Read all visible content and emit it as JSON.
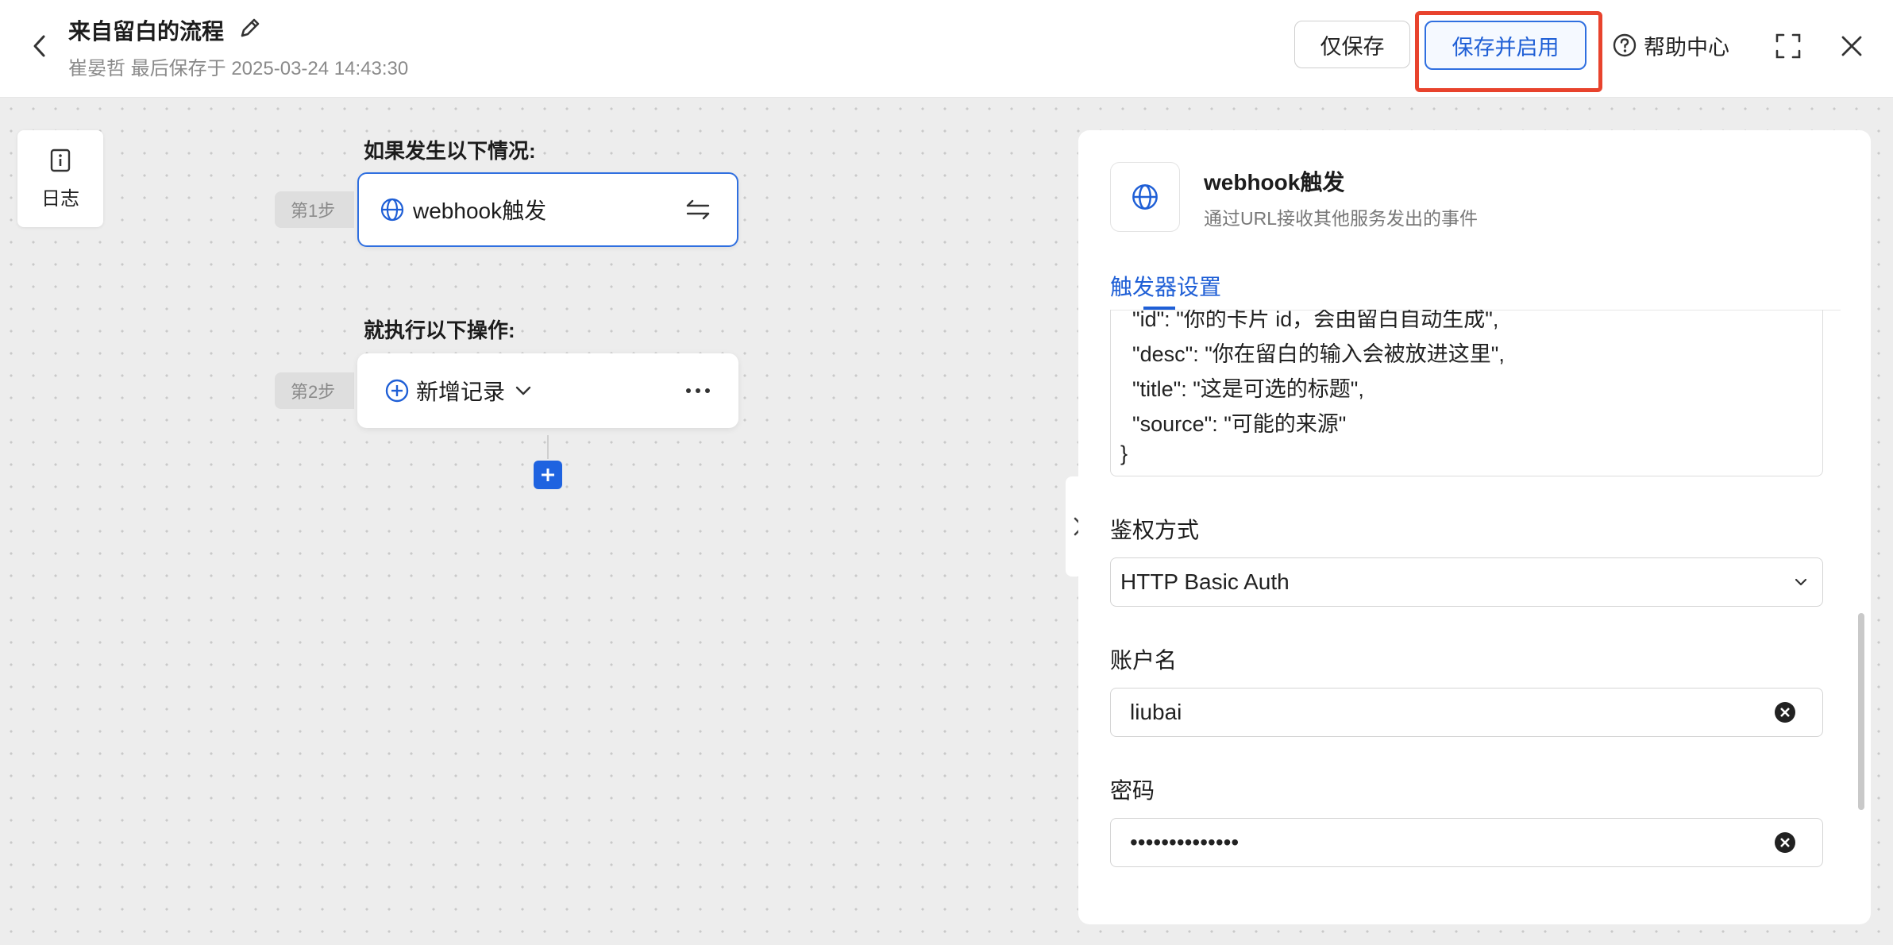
{
  "header": {
    "title": "来自留白的流程",
    "subtitle": "崔晏哲 最后保存于 2025-03-24 14:43:30",
    "save_only_label": "仅保存",
    "save_enable_label": "保存并启用",
    "help_label": "帮助中心"
  },
  "sidebar": {
    "log_label": "日志"
  },
  "flow": {
    "if_label": "如果发生以下情况:",
    "then_label": "就执行以下操作:",
    "step1_tag": "第1步",
    "step2_tag": "第2步",
    "trigger_label": "webhook触发",
    "action_label": "新增记录"
  },
  "panel": {
    "title": "webhook触发",
    "description": "通过URL接收其他服务发出的事件",
    "tab_label": "触发器设置",
    "code_lines": [
      "  \"id\": \"你的卡片 id，会由留白自动生成\",",
      "  \"desc\": \"你在留白的输入会被放进这里\",",
      "  \"title\": \"这是可选的标题\",",
      "  \"source\": \"可能的来源\"",
      "}"
    ],
    "auth_label": "鉴权方式",
    "auth_value": "HTTP Basic Auth",
    "username_label": "账户名",
    "username_value": "liubai",
    "password_label": "密码",
    "password_value": "••••••••••••••"
  },
  "colors": {
    "accent": "#1f5fd6",
    "highlight": "#e8432d"
  },
  "icons": {
    "back": "chevron-left-icon",
    "edit": "pencil-icon",
    "help": "question-circle-icon",
    "fullscreen": "expand-icon",
    "close": "close-icon",
    "log": "info-doc-icon",
    "trigger": "globe-icon",
    "swap": "swap-icon",
    "action": "plus-circle-icon",
    "more": "ellipsis-icon"
  }
}
